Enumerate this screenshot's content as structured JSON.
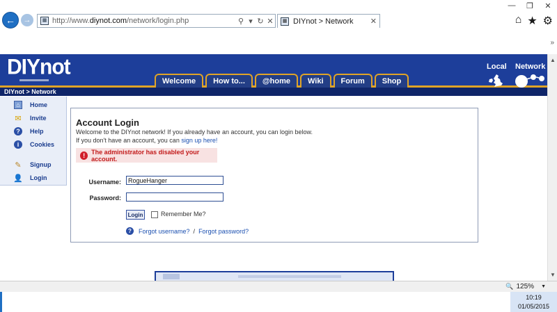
{
  "browser": {
    "url_prefix": "http://www.",
    "url_domain": "diynot.com",
    "url_path": "/network/login.php",
    "tab_title": "DIYnot > Network",
    "icons": [
      "back-arrow-icon",
      "forward-arrow-icon",
      "search-icon",
      "refresh-icon",
      "home-icon",
      "star-icon",
      "gear-icon"
    ]
  },
  "site": {
    "logo": "DIYnot",
    "nav_tabs": [
      "Welcome",
      "How to...",
      "@home",
      "Wiki",
      "Forum",
      "Shop"
    ],
    "header_local": "Local",
    "header_network": "Network",
    "breadcrumb": "DIYnot > Network",
    "colors": {
      "header_blue": "#1d3e9a",
      "accent_gold": "#e0a427",
      "link_blue": "#1a4fb0",
      "error_red": "#c21a1a"
    }
  },
  "sidebar": {
    "items": [
      {
        "label": "Home",
        "icon": "home-icon"
      },
      {
        "label": "Invite",
        "icon": "envelope-icon"
      },
      {
        "label": "Help",
        "icon": "help-icon"
      },
      {
        "label": "Cookies",
        "icon": "info-icon"
      },
      {
        "label": "Signup",
        "icon": "pencil-icon"
      },
      {
        "label": "Login",
        "icon": "user-icon"
      }
    ]
  },
  "login": {
    "title": "Account Login",
    "intro_line1": "Welcome to the DIYnot network! If you already have an account, you can login below.",
    "intro_line2_pre": "If you don't have an account, you can ",
    "intro_line2_link": "sign up here!",
    "error": "The administrator has disabled your account.",
    "username_label": "Username:",
    "username_value": "RogueHanger",
    "password_label": "Password:",
    "password_value": "",
    "login_button": "Login",
    "remember_label": "Remember Me?",
    "forgot_username": "Forgot username?",
    "forgot_separator": "/",
    "forgot_password": "Forgot password?"
  },
  "status": {
    "zoom": "125%"
  },
  "taskbar": {
    "time": "10:19",
    "date": "01/05/2015"
  }
}
